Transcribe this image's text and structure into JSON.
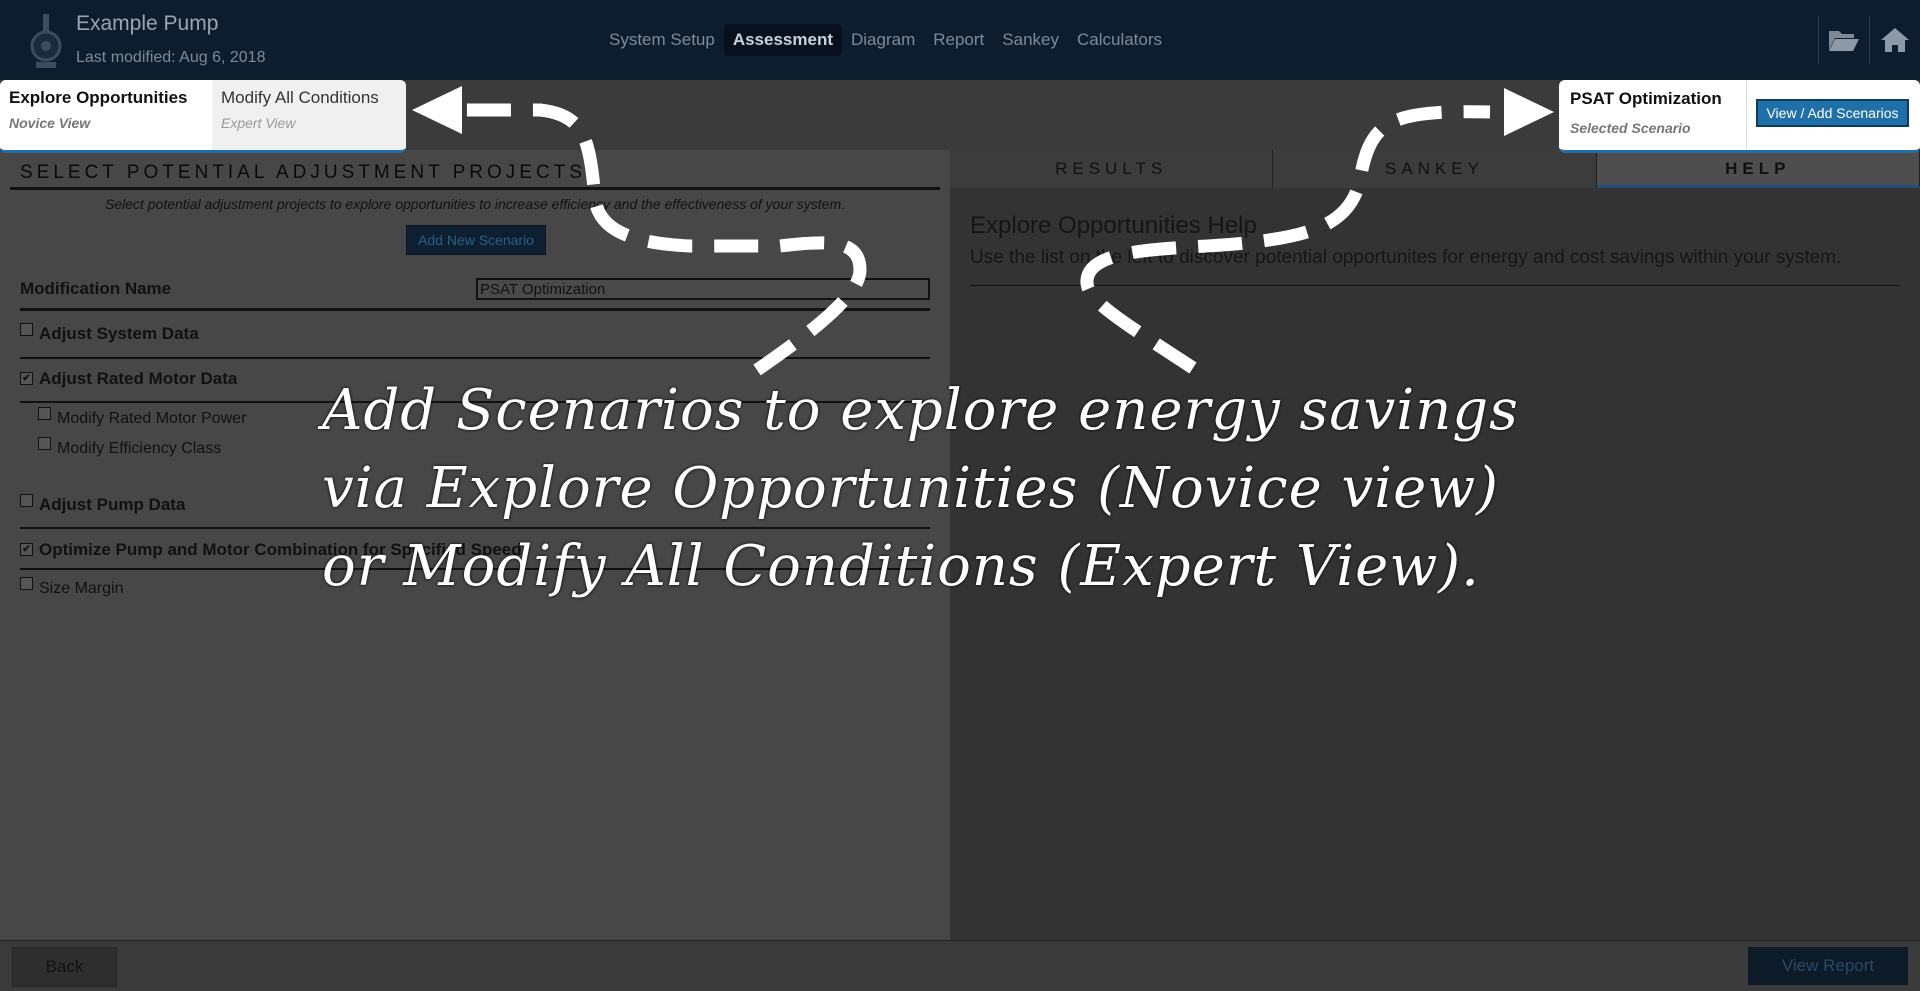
{
  "header": {
    "title": "Example Pump",
    "subtitle": "Last modified: Aug 6, 2018",
    "nav": [
      "System Setup",
      "Assessment",
      "Diagram",
      "Report",
      "Sankey",
      "Calculators"
    ],
    "active_nav": "Assessment"
  },
  "mode_toggle": {
    "explore": {
      "label": "Explore Opportunities",
      "sub": "Novice View"
    },
    "modify": {
      "label": "Modify All Conditions",
      "sub": "Expert View"
    }
  },
  "scenario_box": {
    "name": "PSAT Optimization",
    "sub": "Selected Scenario",
    "button": "View / Add Scenarios"
  },
  "left": {
    "section_title": "SELECT POTENTIAL ADJUSTMENT PROJECTS",
    "description": "Select potential adjustment projects to explore opportunities to increase efficiency and the effectiveness of your system.",
    "add_button": "Add New Scenario",
    "mod_label": "Modification Name",
    "mod_value": "PSAT Optimization",
    "options": [
      {
        "label": "Adjust System Data",
        "checked": false
      },
      {
        "label": "Adjust Rated Motor Data",
        "checked": true
      },
      {
        "label": "Modify Rated Motor Power",
        "checked": false
      },
      {
        "label": "Modify Efficiency Class",
        "checked": false
      },
      {
        "label": "Adjust Pump Data",
        "checked": false
      },
      {
        "label": "Optimize Pump and Motor Combination for Specified Speed",
        "checked": true
      },
      {
        "label": "Size Margin",
        "checked": false
      }
    ]
  },
  "right": {
    "tabs": [
      "RESULTS",
      "SANKEY",
      "HELP"
    ],
    "active_tab": "HELP",
    "help_title": "Explore Opportunities Help",
    "help_text": "Use the list on the left to discover potential opportunites for energy and cost savings within your system."
  },
  "footer": {
    "back": "Back",
    "report": "View Report"
  },
  "annotation": {
    "line1": "Add Scenarios to explore energy savings",
    "line2": "via Explore Opportunities (Novice view)",
    "line3": "or Modify All Conditions (Expert View)."
  }
}
